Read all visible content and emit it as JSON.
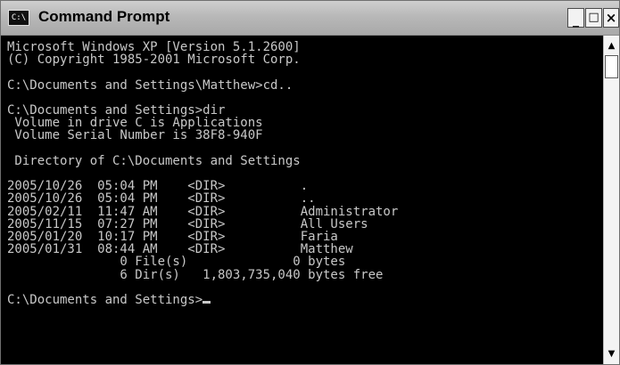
{
  "window": {
    "title": "Command Prompt",
    "icon_label": "C:\\",
    "minimize_glyph": "_",
    "maximize_glyph": "□",
    "close_glyph": "×"
  },
  "console": {
    "lines": [
      "Microsoft Windows XP [Version 5.1.2600]",
      "(C) Copyright 1985-2001 Microsoft Corp.",
      "",
      "C:\\Documents and Settings\\Matthew>cd..",
      "",
      "C:\\Documents and Settings>dir",
      " Volume in drive C is Applications",
      " Volume Serial Number is 38F8-940F",
      "",
      " Directory of C:\\Documents and Settings",
      "",
      "2005/10/26  05:04 PM    <DIR>          .",
      "2005/10/26  05:04 PM    <DIR>          ..",
      "2005/02/11  11:47 AM    <DIR>          Administrator",
      "2005/11/15  07:27 PM    <DIR>          All Users",
      "2005/01/20  10:17 PM    <DIR>          Faria",
      "2005/01/31  08:44 AM    <DIR>          Matthew",
      "               0 File(s)              0 bytes",
      "               6 Dir(s)   1,803,735,040 bytes free",
      ""
    ],
    "prompt": "C:\\Documents and Settings>"
  },
  "scrollbar": {
    "up_glyph": "▲",
    "down_glyph": "▼"
  },
  "colors": {
    "console_bg": "#000000",
    "console_fg": "#c8c8c8"
  }
}
